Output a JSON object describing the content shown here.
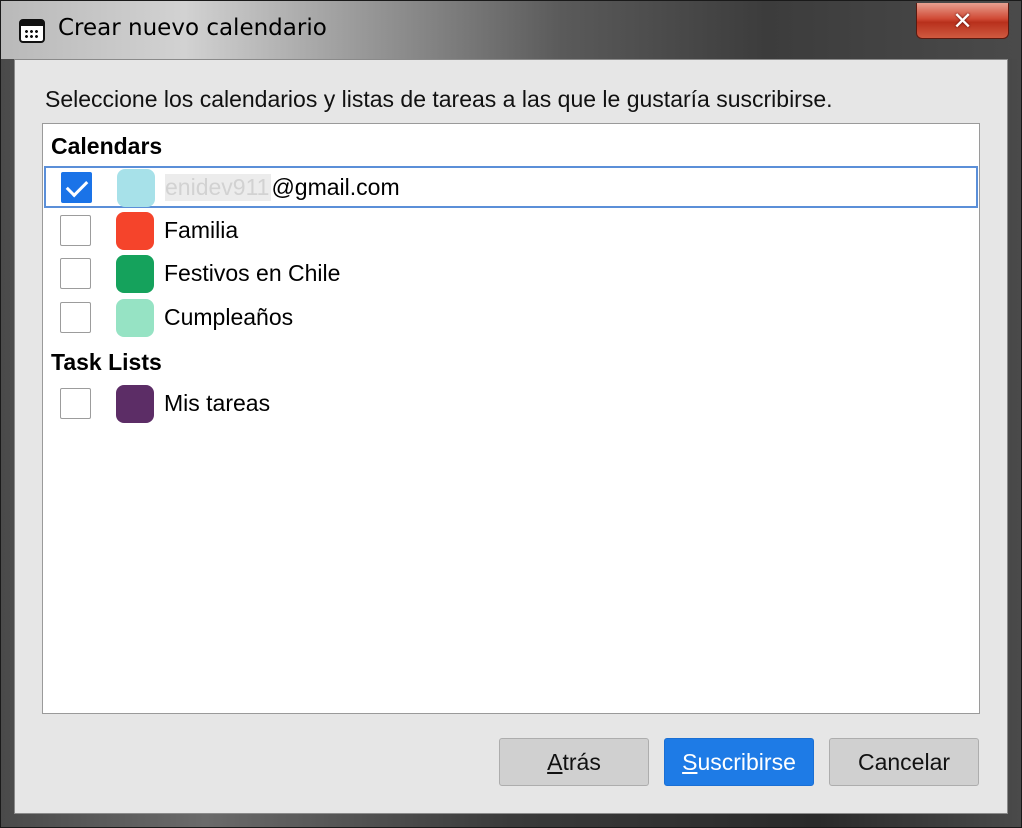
{
  "window": {
    "title": "Crear nuevo calendario",
    "close_glyph": "✕"
  },
  "instruction": "Seleccione los calendarios y listas de tareas a las que le gustaría suscribirse.",
  "groups": {
    "calendars": {
      "header": "Calendars",
      "items": [
        {
          "label_redacted": "enidev911",
          "label_suffix": "@gmail.com",
          "checked": true,
          "color": "#a7e1e9",
          "selected": true
        },
        {
          "label": "Familia",
          "checked": false,
          "color": "#f5442b"
        },
        {
          "label": "Festivos en Chile",
          "checked": false,
          "color": "#15a25c"
        },
        {
          "label": "Cumpleaños",
          "checked": false,
          "color": "#96e3c4"
        }
      ]
    },
    "task_lists": {
      "header": "Task Lists",
      "items": [
        {
          "label": "Mis tareas",
          "checked": false,
          "color": "#5c2d66"
        }
      ]
    }
  },
  "buttons": {
    "back": {
      "mnemonic": "A",
      "rest": "trás"
    },
    "subscribe": {
      "mnemonic": "S",
      "rest": "uscribirse"
    },
    "cancel": {
      "label": "Cancelar"
    }
  },
  "colors": {
    "accent": "#1e7be6",
    "close": "#c8402a"
  }
}
